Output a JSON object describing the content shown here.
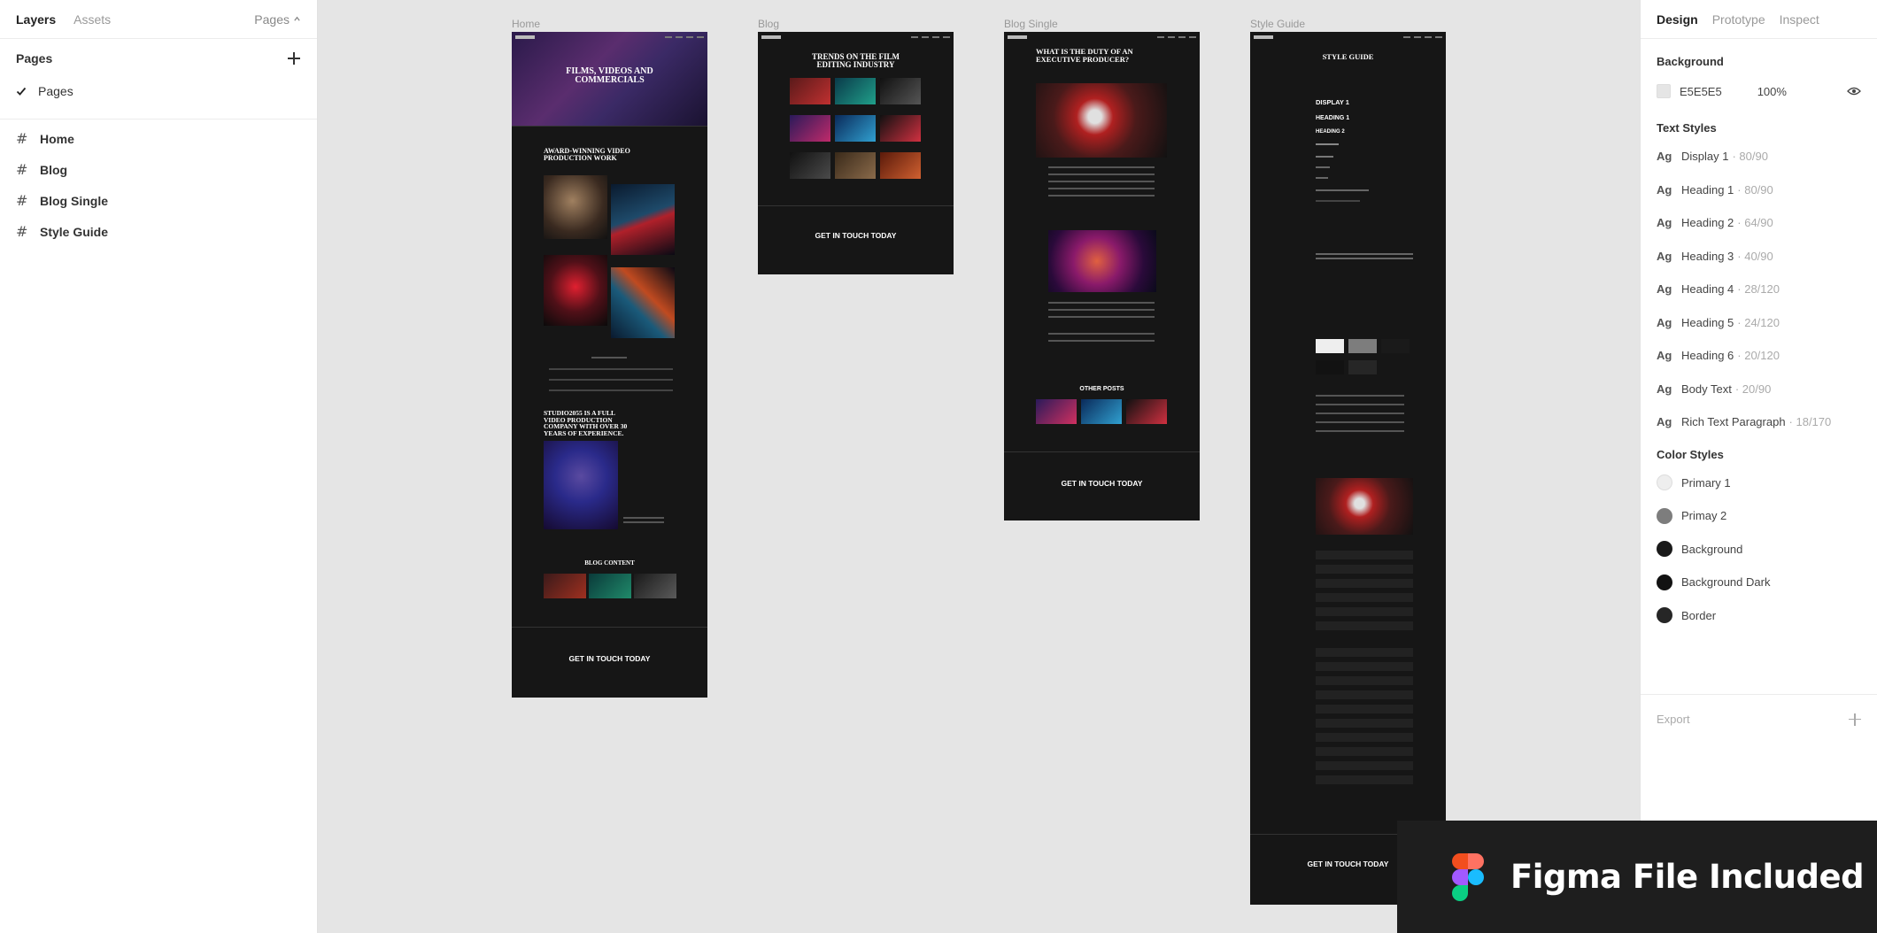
{
  "left_panel": {
    "tabs": [
      "Layers",
      "Assets"
    ],
    "pages_dropdown": "Pages",
    "pages_header": "Pages",
    "current_page": "Pages",
    "layers": [
      "Home",
      "Blog",
      "Blog Single",
      "Style Guide"
    ]
  },
  "canvas": {
    "frames": [
      {
        "label": "Home",
        "hero_title": "FILMS, VIDEOS AND COMMERCIALS",
        "section_title": "AWARD-WINNING VIDEO PRODUCTION WORK",
        "about_title": "STUDIO2055 IS A FULL VIDEO PRODUCTION COMPANY WITH OVER 30 YEARS OF EXPERIENCE.",
        "blog_title": "BLOG CONTENT",
        "cta": "GET IN TOUCH TODAY"
      },
      {
        "label": "Blog",
        "hero_title": "TRENDS ON THE FILM EDITING INDUSTRY",
        "cta": "GET IN TOUCH TODAY"
      },
      {
        "label": "Blog Single",
        "hero_title": "WHAT IS THE DUTY OF AN EXECUTIVE PRODUCER?",
        "other_posts": "OTHER POSTS",
        "cta": "GET IN TOUCH TODAY"
      },
      {
        "label": "Style Guide",
        "hero_title": "STYLE GUIDE",
        "display1": "DISPLAY 1",
        "heading1": "HEADING 1",
        "heading2": "HEADING 2",
        "cta": "GET IN TOUCH TODAY"
      }
    ]
  },
  "right_panel": {
    "tabs": [
      "Design",
      "Prototype",
      "Inspect"
    ],
    "background": {
      "title": "Background",
      "hex": "E5E5E5",
      "opacity": "100%",
      "color": "#e5e5e5"
    },
    "text_styles_title": "Text Styles",
    "text_styles": [
      {
        "name": "Display 1",
        "spec": "· 80/90"
      },
      {
        "name": "Heading 1",
        "spec": "· 80/90"
      },
      {
        "name": "Heading 2",
        "spec": "· 64/90"
      },
      {
        "name": "Heading 3",
        "spec": "· 40/90"
      },
      {
        "name": "Heading 4",
        "spec": "· 28/120"
      },
      {
        "name": "Heading 5",
        "spec": "· 24/120"
      },
      {
        "name": "Heading 6",
        "spec": "· 20/120"
      },
      {
        "name": "Body Text",
        "spec": "· 20/90"
      },
      {
        "name": "Rich Text Paragraph",
        "spec": "· 18/170"
      }
    ],
    "color_styles_title": "Color Styles",
    "color_styles": [
      {
        "name": "Primary 1",
        "color": "#eeeeee"
      },
      {
        "name": "Primay 2",
        "color": "#7d7d7d"
      },
      {
        "name": "Background",
        "color": "#1a1a1a"
      },
      {
        "name": "Background Dark",
        "color": "#121212"
      },
      {
        "name": "Border",
        "color": "#262626"
      }
    ],
    "export_label": "Export"
  },
  "banner": {
    "text": "Figma File Included"
  }
}
